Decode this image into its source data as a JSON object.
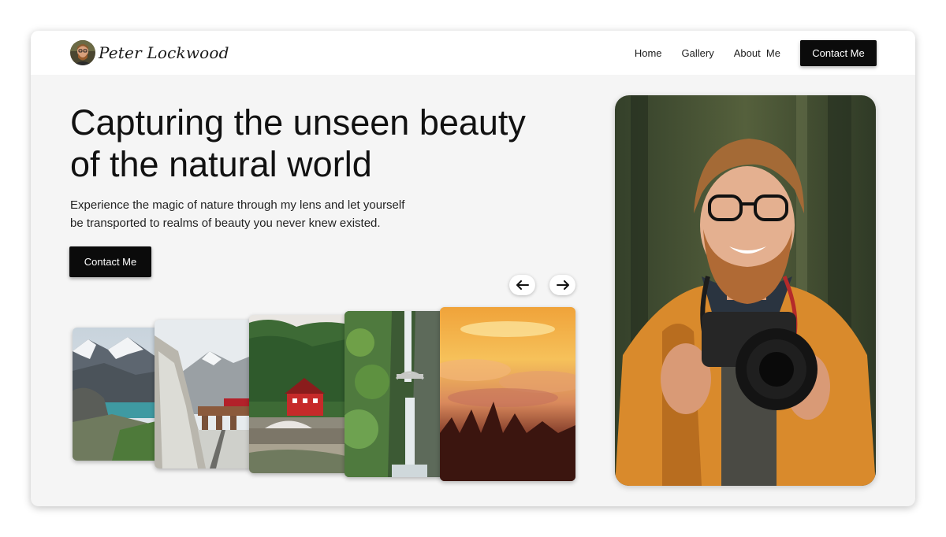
{
  "brand": {
    "name": "Peter Lockwood"
  },
  "nav": {
    "items": [
      {
        "label": "Home"
      },
      {
        "label": "Gallery"
      },
      {
        "label": "About  Me"
      }
    ],
    "contact_label": "Contact Me"
  },
  "hero": {
    "headline": "Capturing the unseen beauty of the natural world",
    "subtext": "Experience the magic of nature through my lens and let yourself be transported to realms of beauty you never knew existed.",
    "cta_label": "Contact Me"
  },
  "carousel": {
    "prev_icon": "arrow-left-icon",
    "next_icon": "arrow-right-icon",
    "photos": [
      {
        "subject": "snowy-mountain-lake"
      },
      {
        "subject": "snowy-railway-viaduct"
      },
      {
        "subject": "red-house-stone-bridge"
      },
      {
        "subject": "forest-waterfall"
      },
      {
        "subject": "sunset-over-clouds"
      }
    ]
  },
  "colors": {
    "accent": "#0b0b0b",
    "background": "#f5f5f5",
    "header": "#ffffff"
  }
}
